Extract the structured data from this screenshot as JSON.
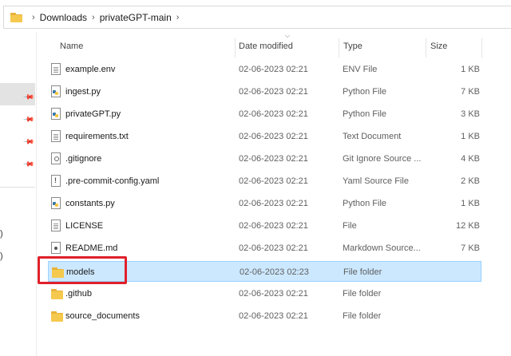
{
  "breadcrumb": {
    "items": [
      "Downloads",
      "privateGPT-main"
    ],
    "separator": "›"
  },
  "nav_fragments": [
    ")",
    ")"
  ],
  "columns": {
    "name": "Name",
    "date": "Date modified",
    "type": "Type",
    "size": "Size"
  },
  "files": [
    {
      "name": "example.env",
      "date": "02-06-2023 02:21",
      "type": "ENV File",
      "size": "1 KB",
      "icon": "text-file-icon"
    },
    {
      "name": "ingest.py",
      "date": "02-06-2023 02:21",
      "type": "Python File",
      "size": "7 KB",
      "icon": "python-file-icon"
    },
    {
      "name": "privateGPT.py",
      "date": "02-06-2023 02:21",
      "type": "Python File",
      "size": "3 KB",
      "icon": "python-file-icon"
    },
    {
      "name": "requirements.txt",
      "date": "02-06-2023 02:21",
      "type": "Text Document",
      "size": "1 KB",
      "icon": "text-file-icon"
    },
    {
      "name": ".gitignore",
      "date": "02-06-2023 02:21",
      "type": "Git Ignore Source ...",
      "size": "4 KB",
      "icon": "gitignore-file-icon"
    },
    {
      "name": ".pre-commit-config.yaml",
      "date": "02-06-2023 02:21",
      "type": "Yaml Source File",
      "size": "2 KB",
      "icon": "yaml-file-icon"
    },
    {
      "name": "constants.py",
      "date": "02-06-2023 02:21",
      "type": "Python File",
      "size": "1 KB",
      "icon": "python-file-icon"
    },
    {
      "name": "LICENSE",
      "date": "02-06-2023 02:21",
      "type": "File",
      "size": "12 KB",
      "icon": "blank-file-icon"
    },
    {
      "name": "README.md",
      "date": "02-06-2023 02:21",
      "type": "Markdown Source...",
      "size": "7 KB",
      "icon": "markdown-file-icon"
    },
    {
      "name": "models",
      "date": "02-06-2023 02:23",
      "type": "File folder",
      "size": "",
      "icon": "folder-icon",
      "selected": true
    },
    {
      "name": ".github",
      "date": "02-06-2023 02:21",
      "type": "File folder",
      "size": "",
      "icon": "folder-icon"
    },
    {
      "name": "source_documents",
      "date": "02-06-2023 02:21",
      "type": "File folder",
      "size": "",
      "icon": "folder-icon"
    }
  ],
  "colors": {
    "selection_bg": "#cce8ff",
    "selection_border": "#99d1ff",
    "highlight_box": "#e0202a",
    "folder": "#f5c94e"
  }
}
